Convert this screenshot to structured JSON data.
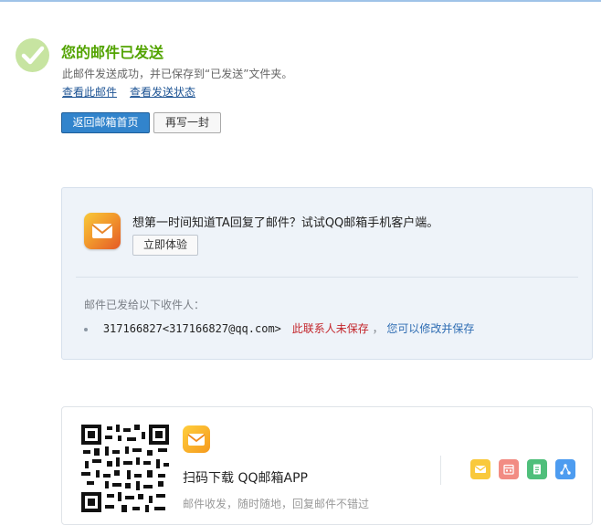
{
  "success": {
    "title": "您的邮件已发送",
    "description": "此邮件发送成功，并已保存到“已发送”文件夹。",
    "view_mail_link": "查看此邮件",
    "view_status_link": "查看发送状态"
  },
  "actions": {
    "back_home": "返回邮箱首页",
    "write_again": "再写一封"
  },
  "promo": {
    "text": "想第一时间知道TA回复了邮件？试试QQ邮箱手机客户端。",
    "try_button": "立即体验"
  },
  "recipients": {
    "label": "邮件已发给以下收件人：",
    "items": [
      {
        "address": "317166827<317166827@qq.com>",
        "warning": "此联系人未保存",
        "separator": "，",
        "save_hint": "您可以修改并保存"
      }
    ]
  },
  "app_download": {
    "title": "扫码下载 QQ邮箱APP",
    "subtitle": "邮件收发，随时随地，回复邮件不错过",
    "feature_icons": [
      "mail-icon",
      "calendar-icon",
      "note-icon",
      "share-icon"
    ]
  },
  "colors": {
    "success_green": "#52a300",
    "primary_button": "#3284cc",
    "warning_red": "#c3242a",
    "link_blue": "#1e5494"
  }
}
